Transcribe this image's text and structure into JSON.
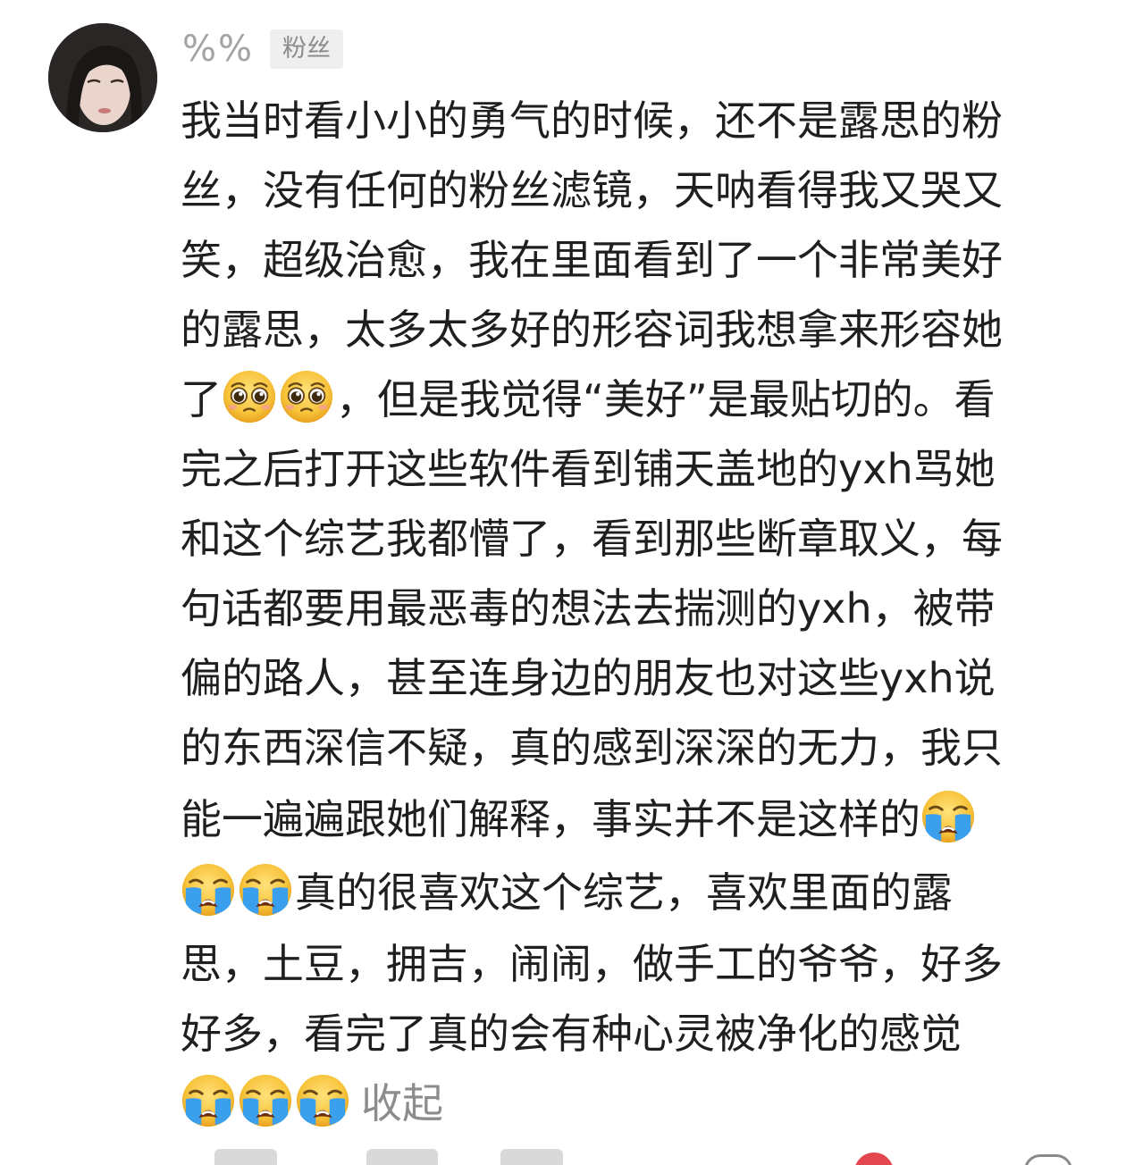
{
  "comment": {
    "user": {
      "name": "%%",
      "badge": "粉丝",
      "avatar_icon": "user-avatar"
    },
    "lines": [
      "我当时看小小的勇气的时候，还不是露思的粉",
      "丝，没有任何的粉丝滤镜，天呐看得我又哭又",
      "笑，超级治愈，我在里面看到了一个非常美好",
      "的露思，太多太多好的形容词我想拿来形容她",
      [
        "了",
        "",
        "，但是我觉得“美好”是最贴切的。看"
      ],
      "完之后打开这些软件看到铺天盖地的yxh骂她",
      "和这个综艺我都懵了，看到那些断章取义，每",
      "句话都要用最恶毒的想法去揣测的yxh，被带",
      "偏的路人，甚至连身边的朋友也对这些yxh说",
      "的东西深信不疑，真的感到深深的无力，我只",
      [
        "能一遍遍跟她们解释，事实并不是这样的",
        ""
      ],
      [
        "",
        "真的很喜欢这个综艺，喜欢里面的露"
      ],
      "思，土豆，拥吉，闹闹，做手工的爷爷，好多",
      "好多，看完了真的会有种心灵被净化的感觉"
    ],
    "collapse_label": "收起",
    "emoji": {
      "pleading": "pleading-face-icon",
      "crying": "loudly-crying-face-icon"
    }
  },
  "colors": {
    "text": "#1f1f1f",
    "muted": "#a3a3a3",
    "badge_bg": "#efefef",
    "link": "#8c8c8c",
    "emoji_yellow": "#f7c33b",
    "tear_blue": "#3aa0ee"
  }
}
